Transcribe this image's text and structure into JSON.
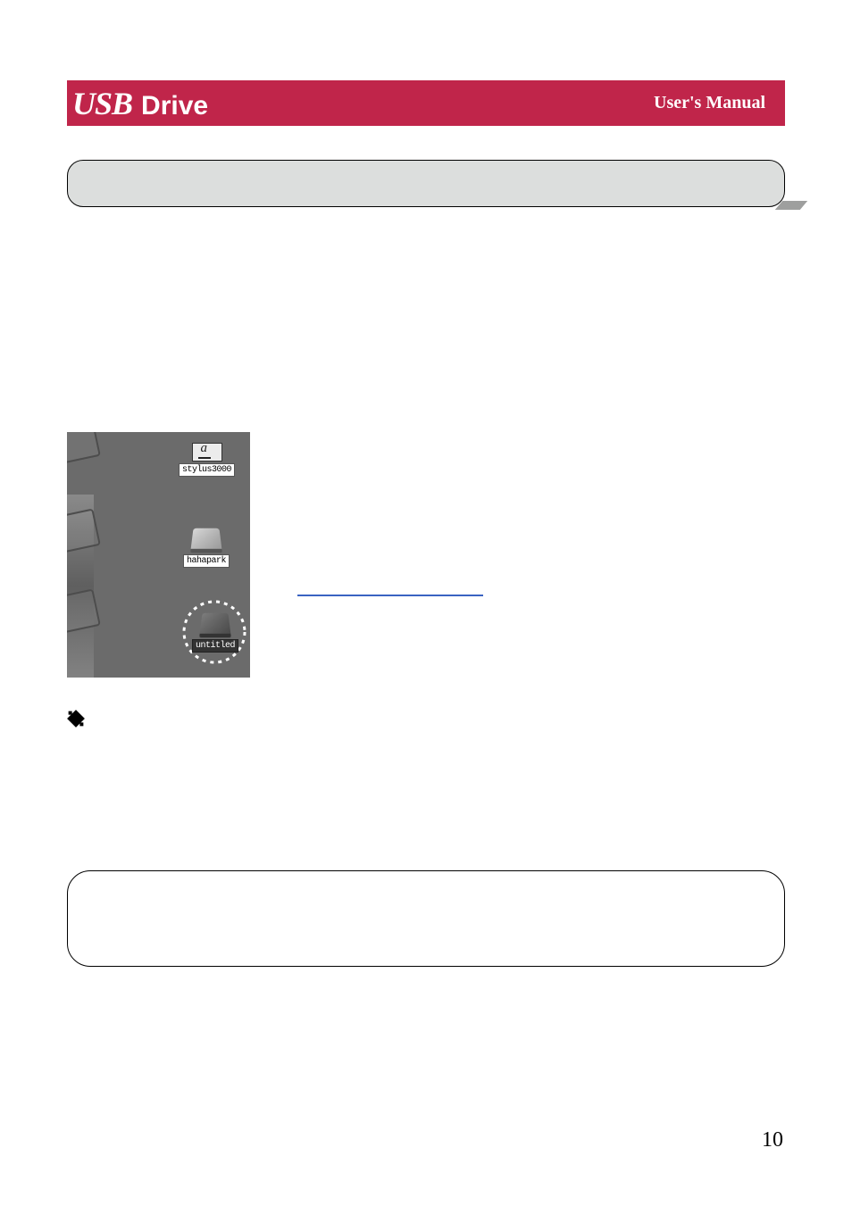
{
  "header": {
    "logo_usb": "USB",
    "logo_drive": "Drive",
    "right": "User's Manual"
  },
  "mac": {
    "item1_label": "stylus3000",
    "item2_label": "hahapark",
    "item3_label": "untitled"
  },
  "page_number": "10"
}
